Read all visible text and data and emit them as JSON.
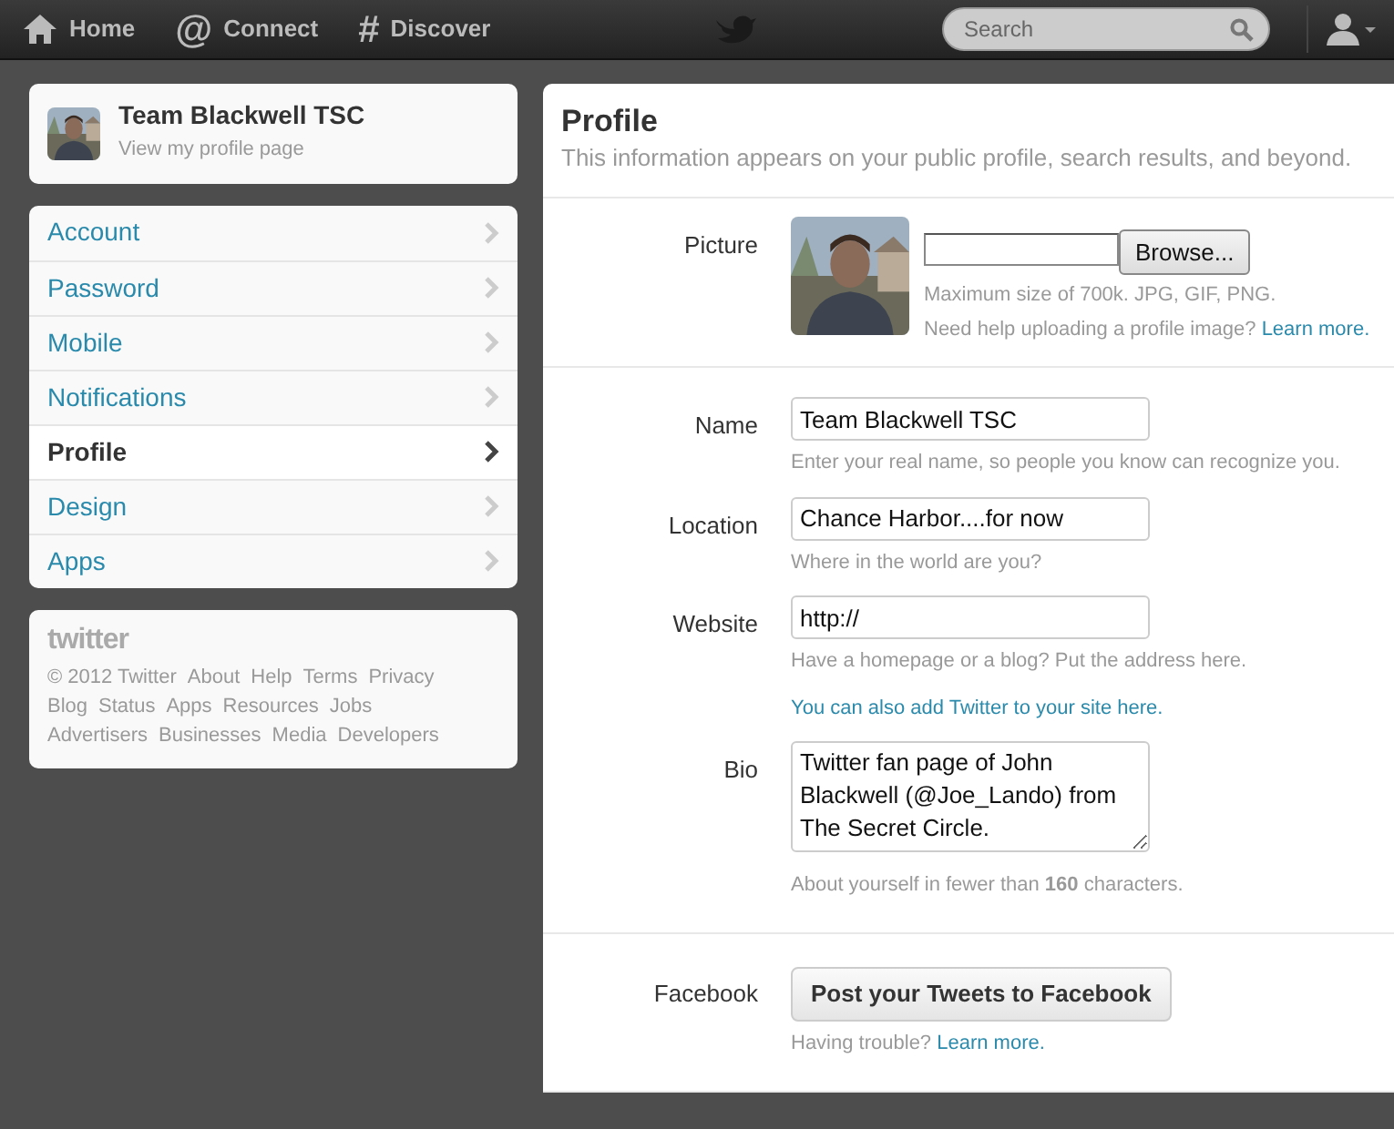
{
  "nav": {
    "items": [
      {
        "label": "Home",
        "kind": "home"
      },
      {
        "label": "Connect",
        "kind": "glyph",
        "glyph": "@"
      },
      {
        "label": "Discover",
        "kind": "glyph",
        "glyph": "#"
      }
    ],
    "search": {
      "placeholder": "Search"
    }
  },
  "sidebar": {
    "profile": {
      "name": "Team Blackwell TSC",
      "link": "View my profile page"
    },
    "items": [
      {
        "label": "Account",
        "selected": false
      },
      {
        "label": "Password",
        "selected": false
      },
      {
        "label": "Mobile",
        "selected": false
      },
      {
        "label": "Notifications",
        "selected": false
      },
      {
        "label": "Profile",
        "selected": true
      },
      {
        "label": "Design",
        "selected": false
      },
      {
        "label": "Apps",
        "selected": false
      }
    ],
    "footer": {
      "logo": "twitter",
      "links": [
        "© 2012 Twitter",
        "About",
        "Help",
        "Terms",
        "Privacy",
        "Blog",
        "Status",
        "Apps",
        "Resources",
        "Jobs",
        "Advertisers",
        "Businesses",
        "Media",
        "Developers"
      ]
    }
  },
  "main": {
    "title": "Profile",
    "subtitle": "This information appears on your public profile, search results, and beyond.",
    "picture": {
      "label": "Picture",
      "button": "Browse...",
      "hint": "Maximum size of 700k. JPG, GIF, PNG.",
      "help": "Need help uploading a profile image?",
      "help_link": "Learn more."
    },
    "fields": [
      {
        "kind": "input",
        "label": "Name",
        "value": "Team Blackwell TSC",
        "hint": "Enter your real name, so people you know can recognize you."
      },
      {
        "kind": "input",
        "label": "Location",
        "value": "Chance Harbor....for now",
        "hint": "Where in the world are you?"
      },
      {
        "kind": "input",
        "label": "Website",
        "value": "http://",
        "hint": "Have a homepage or a blog? Put the address here.",
        "link": "You can also add Twitter to your site here."
      },
      {
        "kind": "textarea",
        "label": "Bio",
        "value": "Twitter fan page of John Blackwell (@Joe_Lando) from The Secret Circle.",
        "hint": "About yourself in fewer than **160** characters."
      }
    ],
    "facebook": {
      "label": "Facebook",
      "button": "Post your Tweets to Facebook",
      "help": "Having trouble?",
      "help_link": "Learn more."
    }
  }
}
